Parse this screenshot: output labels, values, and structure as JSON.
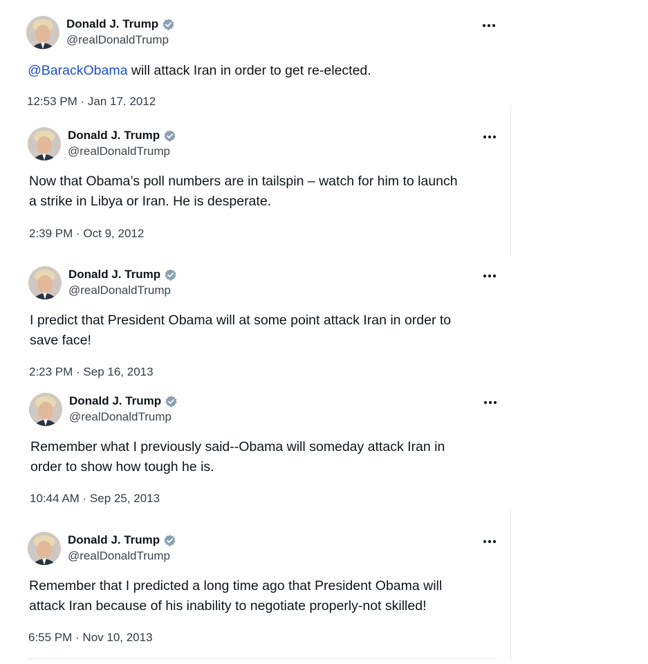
{
  "colors": {
    "text": "#0f1419",
    "secondary_text": "#3c444c",
    "mention": "#1d4ed8",
    "verified_badge": "#8aa0b4",
    "divider": "#e6e9ec"
  },
  "tweets": [
    {
      "author": {
        "name": "Donald J. Trump",
        "handle": "@realDonaldTrump",
        "verified": true,
        "avatar_icon": "profile-photo"
      },
      "text_parts": {
        "mention": "@BarackObama",
        "rest": " will attack Iran in order to get re-elected."
      },
      "timestamp": "12:53 PM · Jan 17. 2012"
    },
    {
      "author": {
        "name": "Donald J. Trump",
        "handle": "@realDonaldTrump",
        "verified": true,
        "avatar_icon": "profile-photo"
      },
      "text_lines": [
        "Now that Obama’s poll numbers are in tailspin – watch for him to launch",
        "a strike in Libya or Iran.  He is desperate."
      ],
      "timestamp": "2:39 PM · Oct 9, 2012"
    },
    {
      "author": {
        "name": "Donald J. Trump",
        "handle": "@realDonaldTrump",
        "verified": true,
        "avatar_icon": "profile-photo"
      },
      "text_lines": [
        "I predict that President Obama will at some point attack Iran in order to",
        "save face!"
      ],
      "timestamp": "2:23 PM · Sep 16, 2013"
    },
    {
      "author": {
        "name": "Donald J. Trump",
        "handle": "@realDonaldTrump",
        "verified": true,
        "avatar_icon": "profile-photo"
      },
      "text_lines": [
        "Remember what I previously said--Obama will someday attack Iran in",
        "order to show how tough he is."
      ],
      "timestamp": "10:44 AM · Sep 25, 2013"
    },
    {
      "author": {
        "name": "Donald J. Trump",
        "handle": "@realDonaldTrump",
        "verified": true,
        "avatar_icon": "profile-photo"
      },
      "text_lines": [
        "Remember that I predicted a long time ago that President Obama will",
        "attack Iran because of his inability to negotiate properly-not skilled!"
      ],
      "timestamp": "6:55 PM · Nov 10, 2013"
    }
  ]
}
